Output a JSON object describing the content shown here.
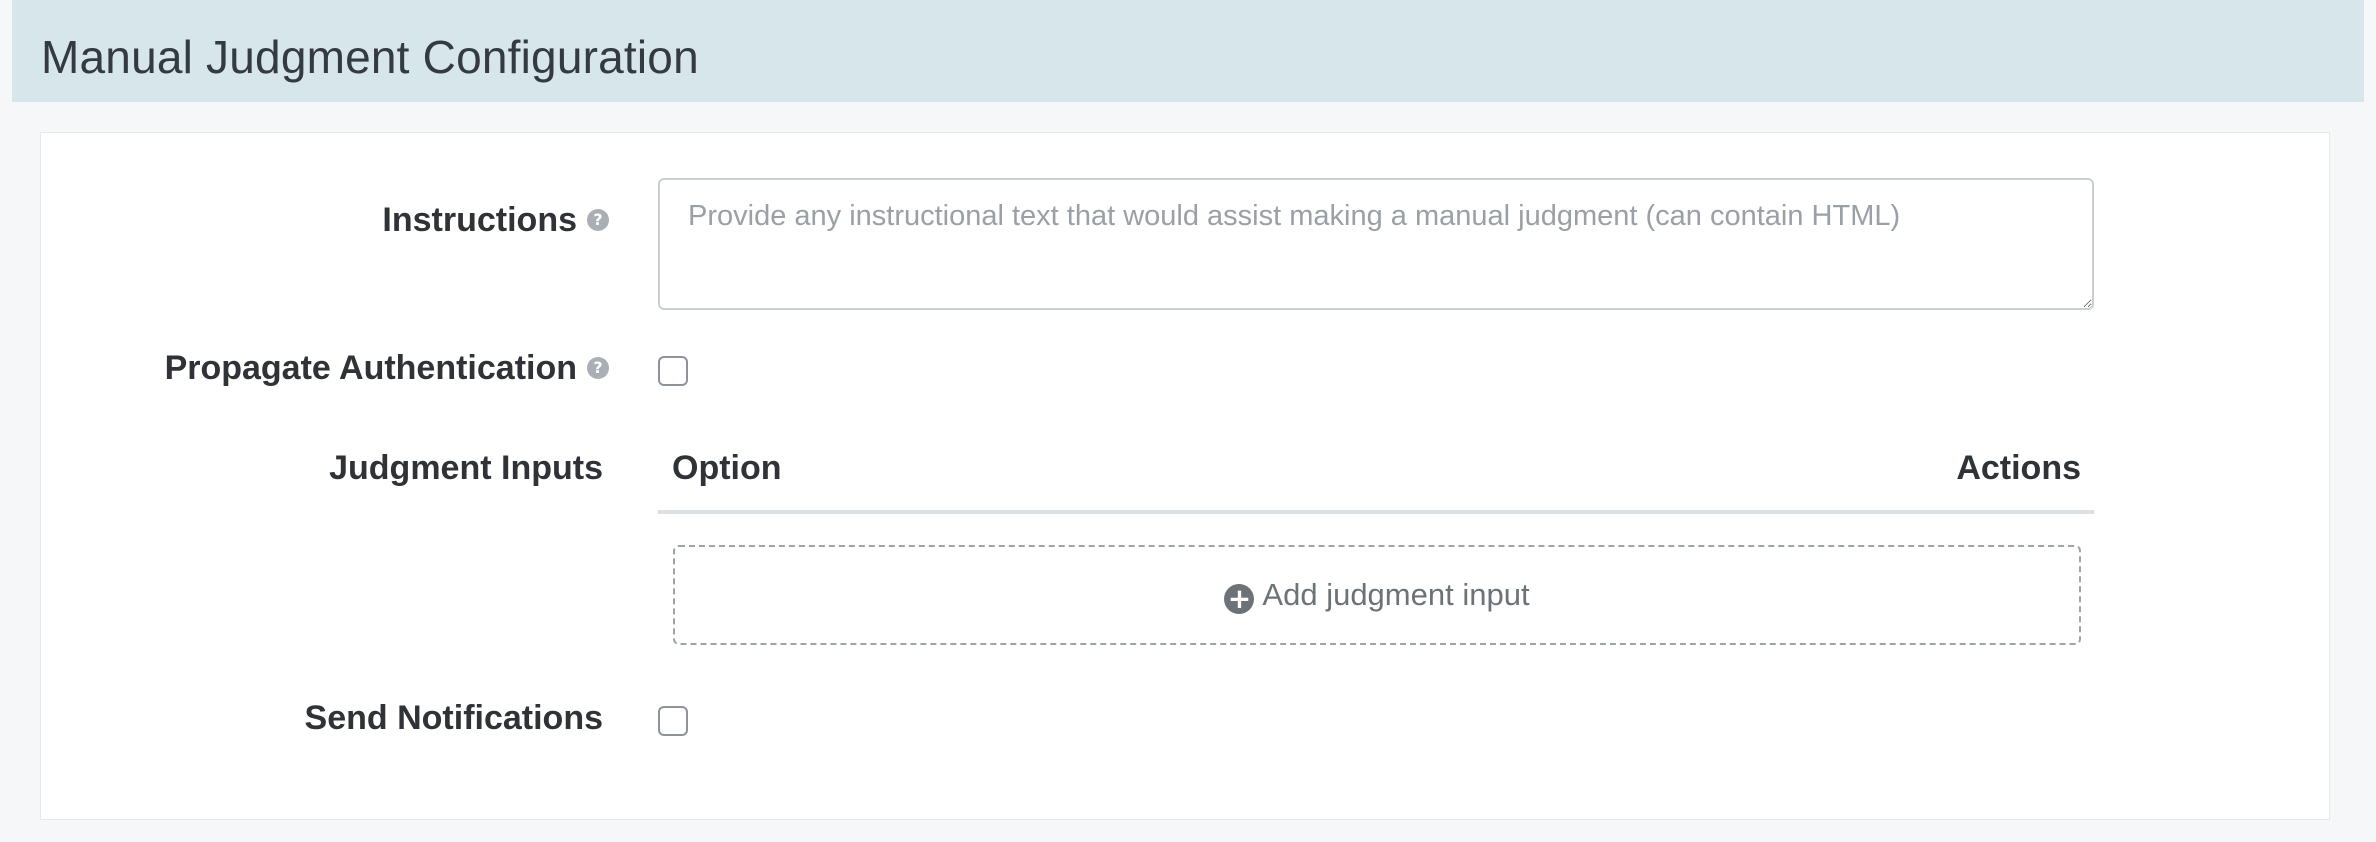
{
  "section": {
    "title": "Manual Judgment Configuration"
  },
  "form": {
    "instructions": {
      "label": "Instructions",
      "help_icon": "question-circle-icon",
      "placeholder": "Provide any instructional text that would assist making a manual judgment (can contain HTML)",
      "value": ""
    },
    "propagate_authentication": {
      "label": "Propagate Authentication",
      "help_icon": "question-circle-icon",
      "checked": false
    },
    "judgment_inputs": {
      "label": "Judgment Inputs",
      "columns": [
        "Option",
        "Actions"
      ],
      "rows": [],
      "add_label": "Add judgment input",
      "add_icon": "plus-circle-icon"
    },
    "send_notifications": {
      "label": "Send Notifications",
      "checked": false
    }
  },
  "colors": {
    "header_background": "#d7e6eb",
    "panel_background": "#ffffff",
    "page_background": "#f6f7f8"
  }
}
